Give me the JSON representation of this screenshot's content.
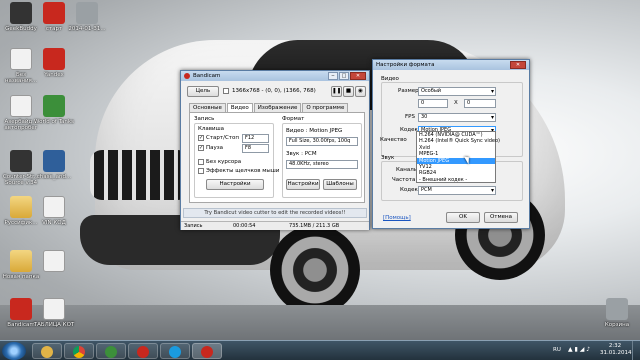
{
  "desktop": {
    "icons": [
      {
        "label": "GeekBuddy",
        "icon": "geekbuddy-icon"
      },
      {
        "label": "старт",
        "icon": "start-app-icon"
      },
      {
        "label": "2014-01-31...",
        "icon": "image-file-icon"
      },
      {
        "label": "Без названия...",
        "icon": "image-file-icon"
      },
      {
        "label": "Yandex",
        "icon": "yandex-icon"
      },
      {
        "label": "Азербайд... автопробег",
        "icon": "mp3-file-icon"
      },
      {
        "label": "World of Tanks",
        "icon": "world-of-tanks-icon"
      },
      {
        "label": "Counter-Str... Source v.34",
        "icon": "counter-strike-icon"
      },
      {
        "label": "chase_and...",
        "icon": "image-file-icon"
      },
      {
        "label": "Руссифик...",
        "icon": "folder-icon"
      },
      {
        "label": "VIN КОД",
        "icon": "document-icon"
      },
      {
        "label": "Новая папка",
        "icon": "folder-icon"
      },
      {
        "label": "Bandicam",
        "icon": "bandicam-icon"
      },
      {
        "label": "ТАБЛИЦА КОТ",
        "icon": "document-icon"
      },
      {
        "label": "Корзина",
        "icon": "recycle-bin-icon"
      }
    ]
  },
  "bandicam": {
    "title": "Bandicam",
    "target_button": "Цель",
    "resolution_text": "1366x768 - (0, 0), (1366, 768)",
    "tabs": [
      "Основные",
      "Видео",
      "Изображение",
      "О программе"
    ],
    "record_group": "Запись",
    "hotkey_label": "Клавиша",
    "start_stop_label": "Старт/Стоп",
    "start_stop_key": "F12",
    "pause_label": "Пауза",
    "pause_key": "F8",
    "no_cursor_label": "Без курсора",
    "click_effects_label": "Эффекты щелчков мыши",
    "settings_button": "Настройки",
    "format_group": "Формат",
    "video_format": "Видео : Motion JPEG",
    "video_details": "Full Size, 30.00fps, 100q",
    "audio_format": "Звук : PCM",
    "audio_details": "48.0KHz, stereo",
    "settings_button_2": "Настройки",
    "templates_button": "Шаблоны",
    "promo_text": "Try Bandicut video cutter to edit the recorded videos!!",
    "status_label": "Запись",
    "status_time": "00:00:54",
    "status_size": "735.1MB / 211.3 GB"
  },
  "format_dialog": {
    "title": "Настройки формата",
    "video_group": "Видео",
    "size_label": "Размер",
    "size_value": "Особый",
    "width_value": "0",
    "x_label": "X",
    "height_value": "0",
    "fps_label": "FPS",
    "fps_value": "30",
    "codec_label": "Кодек",
    "codec_value": "Motion JPEG",
    "quality_label": "Качество",
    "audio_group": "Звук",
    "channels_label": "Каналы",
    "frequency_label": "Частота",
    "audio_codec_label": "Кодек",
    "audio_codec_value": "PCM",
    "help_link": "[Помощь]",
    "ok_button": "OK",
    "cancel_button": "Отмена",
    "codec_options": [
      "H.264 (NVIDIA@ CUDA™)",
      "H.264 (Intel® Quick Sync video)",
      "Xvid",
      "MPEG-1",
      "Motion JPEG",
      "YV12",
      "RGB24",
      "- Внешний кодек -"
    ],
    "selected_codec_index": 4
  },
  "taskbar": {
    "language": "RU",
    "time": "2:32",
    "date": "31.01.2014"
  },
  "colors": {
    "accent": "#3399ff",
    "bandicam_red": "#c8281e",
    "taskbar": "#2b3b48"
  }
}
